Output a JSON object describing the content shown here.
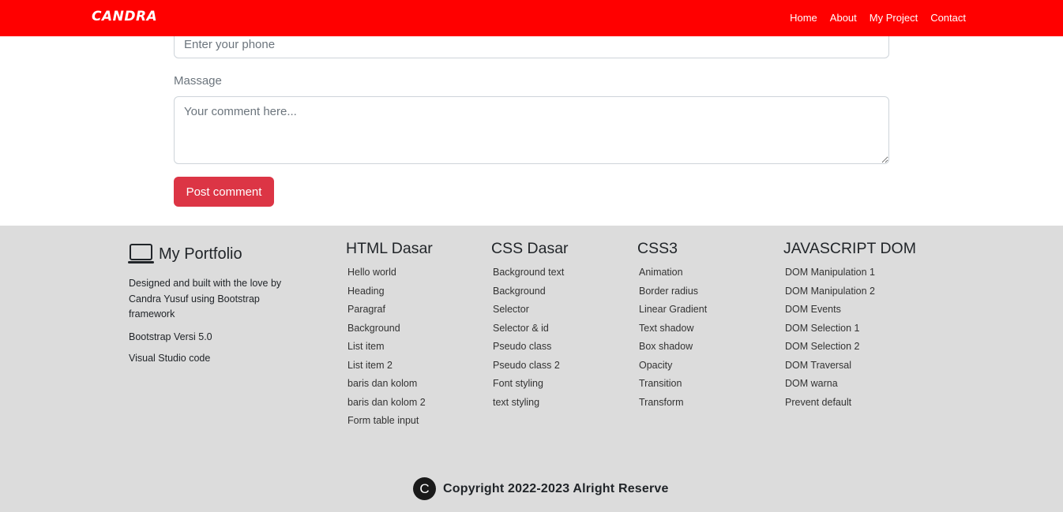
{
  "navbar": {
    "brand": "CANDRA",
    "links": [
      "Home",
      "About",
      "My Project",
      "Contact"
    ]
  },
  "form": {
    "phone_placeholder": "Enter your phone",
    "message_label": "Massage",
    "comment_placeholder": "Your comment here...",
    "submit_label": "Post comment"
  },
  "footer": {
    "portfolio": {
      "icon": "laptop-icon",
      "title": "My Portfolio",
      "description": "Designed and built with the love by Candra Yusuf using Bootstrap framework",
      "version": "Bootstrap Versi 5.0",
      "editor": "Visual Studio code"
    },
    "columns": [
      {
        "title": "HTML Dasar",
        "items": [
          "Hello world",
          "Heading",
          "Paragraf",
          "Background",
          "List item",
          "List item 2",
          "baris dan kolom",
          "baris dan kolom 2",
          "Form table input"
        ]
      },
      {
        "title": "CSS Dasar",
        "items": [
          "Background text",
          "Background",
          "Selector",
          "Selector & id",
          "Pseudo class",
          "Pseudo class 2",
          "Font styling",
          "text styling"
        ]
      },
      {
        "title": "CSS3",
        "items": [
          "Animation",
          "Border radius",
          "Linear Gradient",
          "Text shadow",
          "Box shadow",
          "Opacity",
          "Transition",
          "Transform"
        ]
      },
      {
        "title": "JAVASCRIPT DOM",
        "items": [
          "DOM Manipulation 1",
          "DOM Manipulation 2",
          "DOM Events",
          "DOM Selection 1",
          "DOM Selection 2",
          "DOM Traversal",
          "DOM warna",
          "Prevent default"
        ]
      }
    ],
    "copyright_icon": "C",
    "copyright": "Copyright 2022-2023 Alright Reserve"
  },
  "colors": {
    "navbar": "#ff0000",
    "footer": "#dcdcdc",
    "button": "#dc3545"
  }
}
